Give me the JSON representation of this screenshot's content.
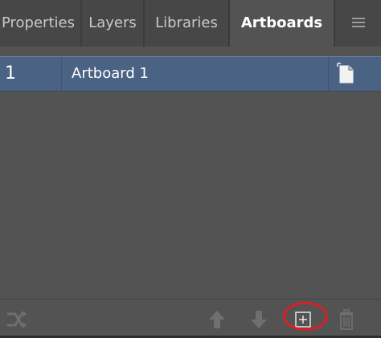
{
  "tabs": [
    {
      "label": "Properties",
      "active": false
    },
    {
      "label": "Layers",
      "active": false
    },
    {
      "label": "Libraries",
      "active": false
    },
    {
      "label": "Artboards",
      "active": true
    }
  ],
  "panel_menu_icon": "hamburger-menu-icon",
  "artboards": [
    {
      "index": "1",
      "name": "Artboard 1",
      "selected": true,
      "options_icon": "artboard-options-icon"
    }
  ],
  "toolbar": {
    "rearrange_icon": "rearrange-icon",
    "move_up_icon": "arrow-up-icon",
    "move_down_icon": "arrow-down-icon",
    "new_artboard_icon": "new-artboard-icon",
    "delete_icon": "trash-icon"
  },
  "colors": {
    "panel_bg": "#535353",
    "tab_bg": "#474747",
    "selected_row": "#4a6385",
    "highlight_ring": "#d91f26"
  }
}
